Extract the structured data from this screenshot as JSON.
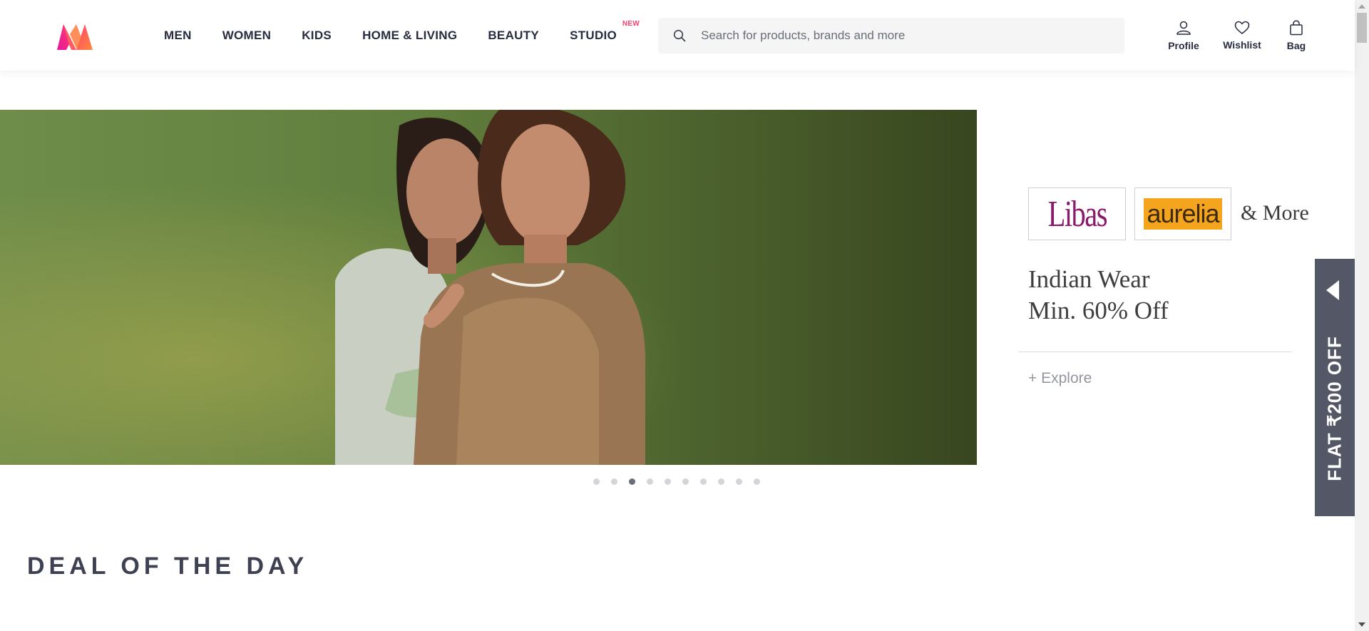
{
  "header": {
    "nav": [
      {
        "label": "MEN"
      },
      {
        "label": "WOMEN"
      },
      {
        "label": "KIDS"
      },
      {
        "label": "HOME & LIVING"
      },
      {
        "label": "BEAUTY"
      },
      {
        "label": "STUDIO",
        "badge": "NEW"
      }
    ],
    "search": {
      "placeholder": "Search for products, brands and more",
      "value": ""
    },
    "actions": {
      "profile": "Profile",
      "wishlist": "Wishlist",
      "bag": "Bag"
    }
  },
  "hero": {
    "brands": [
      "Libas",
      "aurelia"
    ],
    "and_more": "& More",
    "headline_line1": "Indian Wear",
    "headline_line2": "Min. 60% Off",
    "cta": "+ Explore",
    "slide_count": 10,
    "active_slide": 3
  },
  "flat_offer": {
    "label": "FLAT ₹200 OFF"
  },
  "section": {
    "title": "DEAL OF THE DAY"
  },
  "colors": {
    "accent": "#ff3f6c",
    "text": "#282c3f",
    "offer_bg": "#535766"
  }
}
